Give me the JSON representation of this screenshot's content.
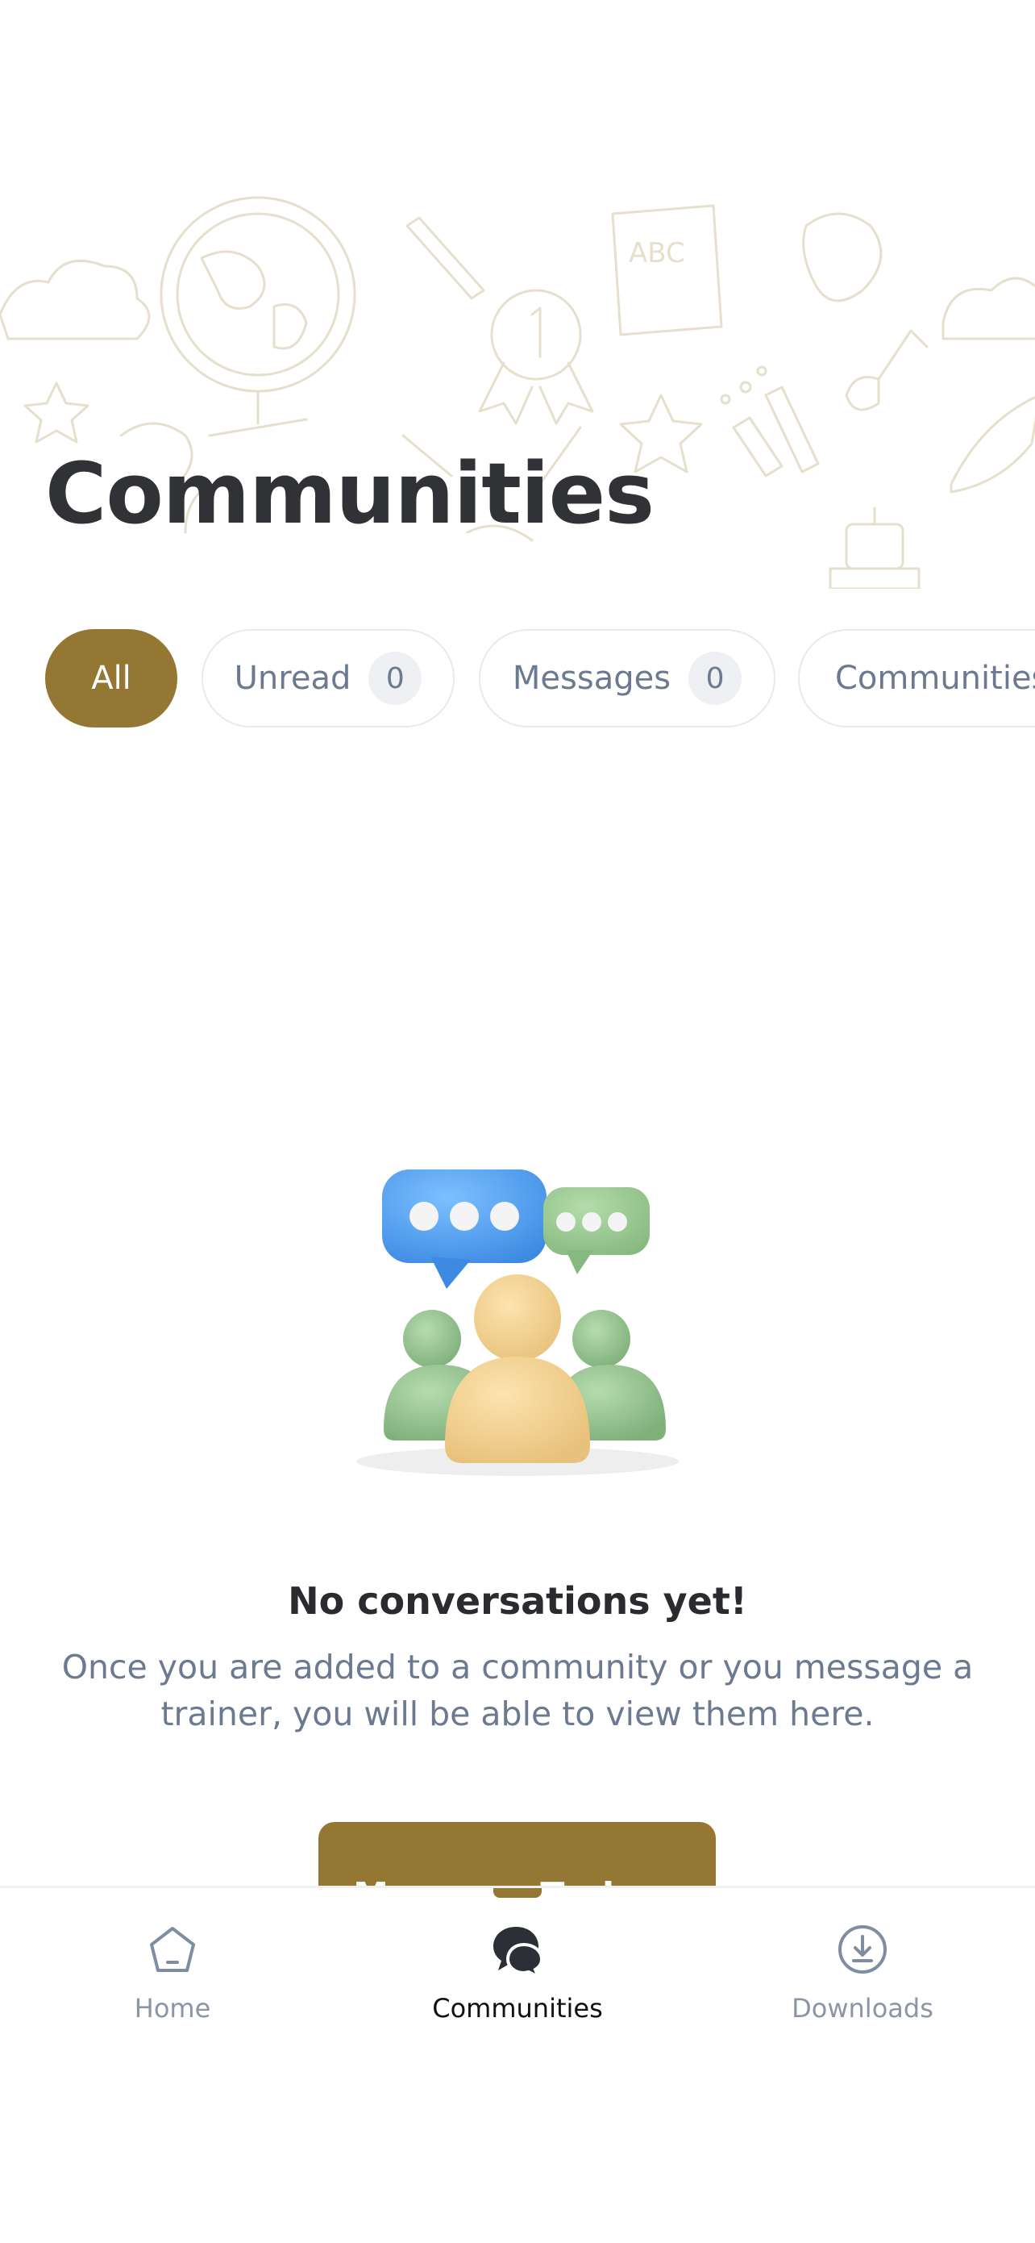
{
  "header": {
    "title": "Communities"
  },
  "filters": [
    {
      "label": "All",
      "active": true
    },
    {
      "label": "Unread",
      "count": "0",
      "active": false
    },
    {
      "label": "Messages",
      "count": "0",
      "active": false
    },
    {
      "label": "Communities",
      "active": false
    }
  ],
  "empty_state": {
    "illustration": "community-chat-illustration",
    "title": "No conversations yet!",
    "description": "Once you are added to a community or you message a trainer, you will be able to view them here.",
    "button_label": "Message Trainer"
  },
  "tabbar": {
    "items": [
      {
        "label": "Home",
        "icon": "home-icon",
        "active": false
      },
      {
        "label": "Communities",
        "icon": "chat-bubbles-icon",
        "active": true
      },
      {
        "label": "Downloads",
        "icon": "download-icon",
        "active": false
      }
    ]
  },
  "colors": {
    "accent": "#957734",
    "title": "#313236",
    "muted_text": "#6b7a90",
    "tab_inactive": "#8a96a8",
    "doodle": "#e8e1cf"
  }
}
